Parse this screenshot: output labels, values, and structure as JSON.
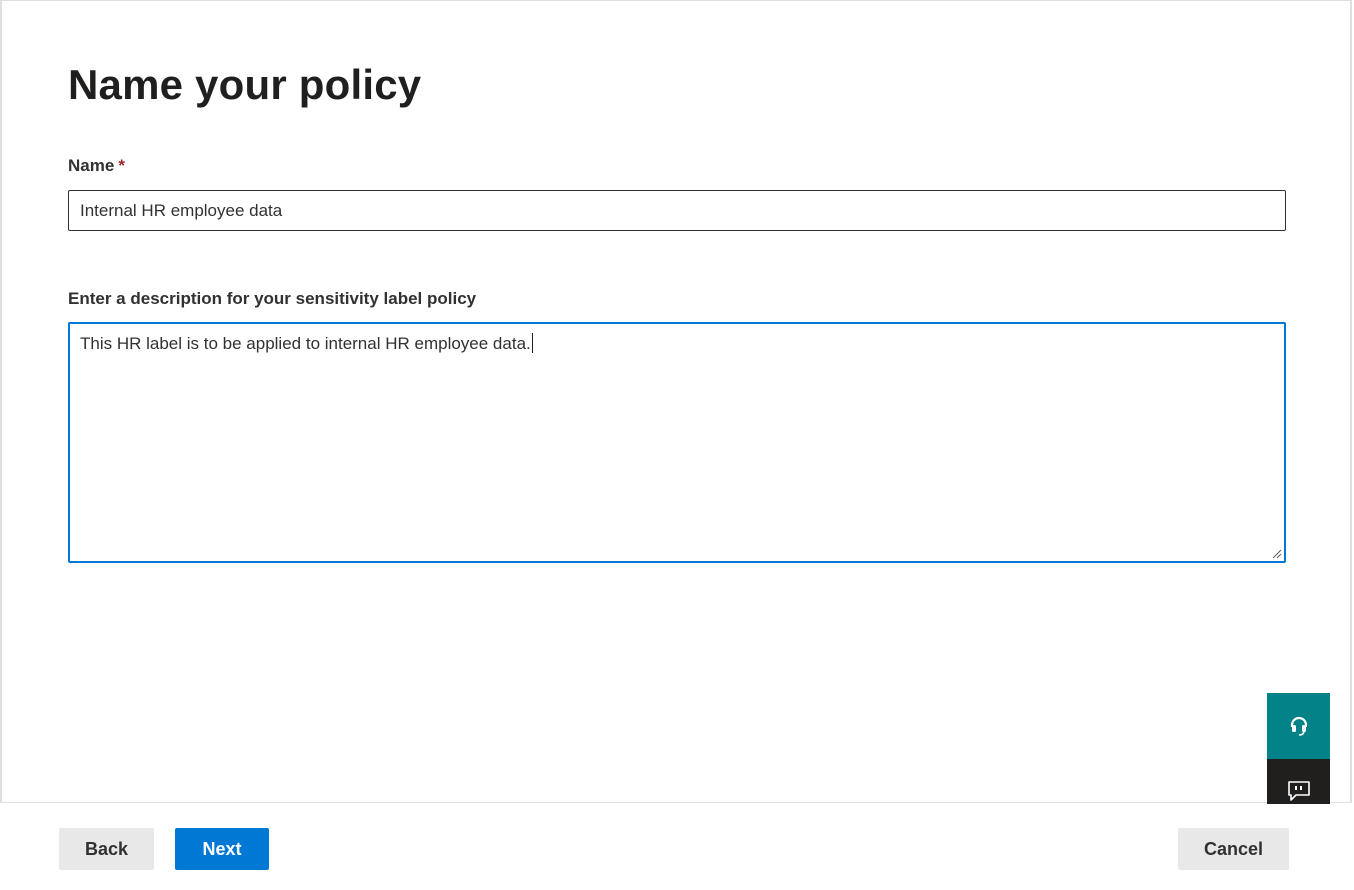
{
  "page": {
    "title": "Name your policy"
  },
  "form": {
    "name_label": "Name",
    "required_mark": "*",
    "name_value": "Internal HR employee data",
    "description_label": "Enter a description for your sensitivity label policy",
    "description_value": "This HR label is to be applied to internal HR employee data."
  },
  "floating_actions": {
    "help_icon": "headset-icon",
    "feedback_icon": "feedback-chat-icon"
  },
  "footer": {
    "back_label": "Back",
    "next_label": "Next",
    "cancel_label": "Cancel"
  },
  "colors": {
    "primary": "#0078d4",
    "help_button": "#038387",
    "feedback_button": "#201f1e",
    "required": "#a4262c",
    "secondary_button": "#e8e8e8"
  }
}
